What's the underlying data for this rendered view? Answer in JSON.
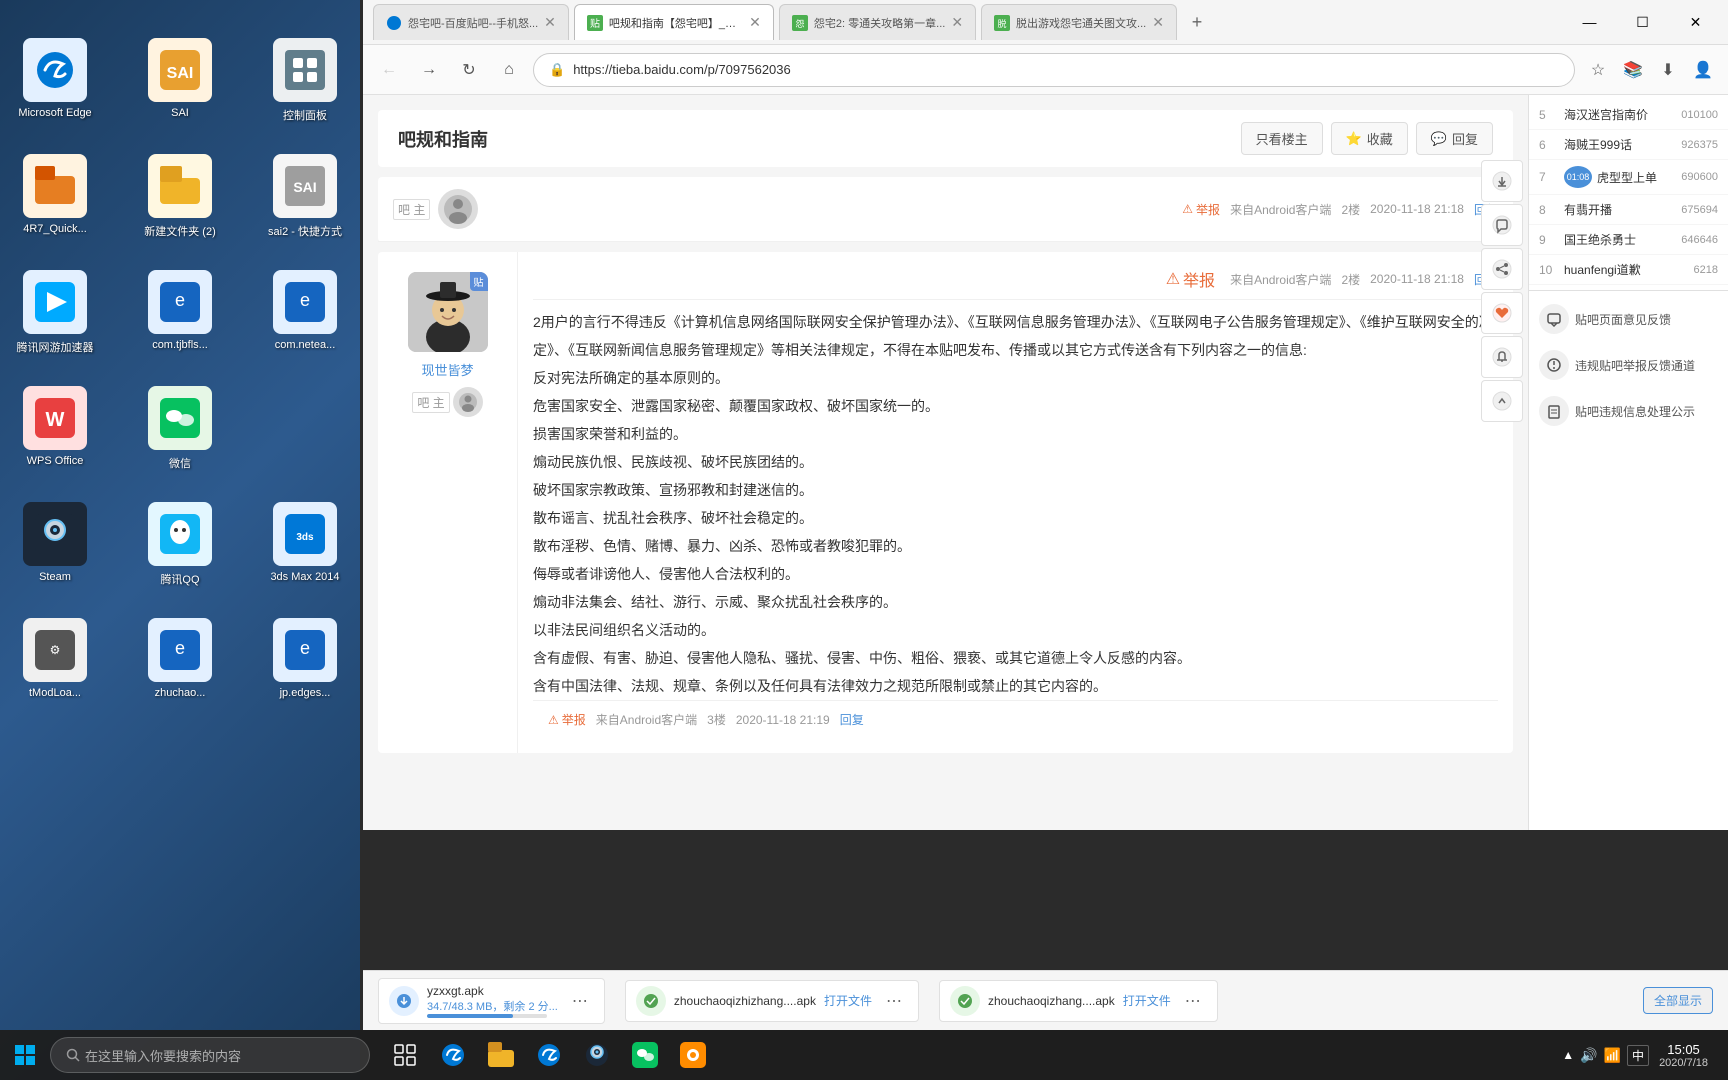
{
  "desktop": {
    "icons": [
      {
        "id": "edge",
        "label": "Microsoft Edge",
        "emoji": "🌐",
        "color": "#0078d4"
      },
      {
        "id": "sai",
        "label": "SAI",
        "emoji": "🎨",
        "color": "#e8a030"
      },
      {
        "id": "control",
        "label": "控制面板",
        "emoji": "⚙️",
        "color": "#607d8b"
      },
      {
        "id": "project",
        "label": "4R7_Quick...",
        "emoji": "📁",
        "color": "#e67e22"
      },
      {
        "id": "new-folder",
        "label": "新建文件夹 (2)",
        "emoji": "📂",
        "color": "#f0b429"
      },
      {
        "id": "method",
        "label": "方式",
        "emoji": "📋",
        "color": "#95a5a6"
      },
      {
        "id": "tencent-accel",
        "label": "腾讯网游加速器",
        "emoji": "🎮",
        "color": "#00aaff"
      },
      {
        "id": "com-tjbfls",
        "label": "com.tjbfls...",
        "emoji": "🌐",
        "color": "#1565c0"
      },
      {
        "id": "com-netea",
        "label": "com.netea...",
        "emoji": "🌐",
        "color": "#1565c0"
      },
      {
        "id": "wps",
        "label": "WPS Office",
        "emoji": "W",
        "color": "#e84040"
      },
      {
        "id": "wechat",
        "label": "微信",
        "emoji": "💬",
        "color": "#07c160"
      },
      {
        "id": "steam",
        "label": "Steam",
        "emoji": "🎮",
        "color": "#1b2838"
      },
      {
        "id": "qq",
        "label": "腾讯QQ",
        "emoji": "🐧",
        "color": "#12b7f5"
      },
      {
        "id": "3dsmax",
        "label": "3ds Max 2014",
        "emoji": "🔷",
        "color": "#0078d7"
      },
      {
        "id": "tmodloader",
        "label": "tModLoa...",
        "emoji": "⚙️",
        "color": "#555"
      },
      {
        "id": "zhuchao",
        "label": "zhuchao...",
        "emoji": "🌐",
        "color": "#1565c0"
      },
      {
        "id": "jpedges2",
        "label": "jp.edges...",
        "emoji": "🌐",
        "color": "#1565c0"
      }
    ]
  },
  "taskbar": {
    "search_placeholder": "在这里输入你要搜索的内容",
    "time": "15:05",
    "date": "2020/7/18",
    "system_tray": [
      "🔊",
      "中"
    ]
  },
  "browser": {
    "tabs": [
      {
        "id": "tab1",
        "label": "怨宅吧-百度贴吧--手机怒...",
        "active": false,
        "favicon": "🔵"
      },
      {
        "id": "tab2",
        "label": "吧规和指南【怨宅吧】_贴...",
        "active": true,
        "favicon": "🟢"
      },
      {
        "id": "tab3",
        "label": "怨宅2: 零通关攻略第一章...",
        "active": false,
        "favicon": "🟩"
      },
      {
        "id": "tab4",
        "label": "脱出游戏怨宅通关图文攻...",
        "active": false,
        "favicon": "🟩"
      }
    ],
    "url": "https://tieba.baidu.com/p/7097562036",
    "page_title": "吧规和指南",
    "action_buttons": [
      "只看楼主",
      "收藏",
      "回复"
    ],
    "post_header": {
      "author_label": "吧 主",
      "meta": "来自Android客户端  2楼  2020-11-18 21:18",
      "report": "举报",
      "reply": "回复"
    },
    "post2": {
      "username": "现世皆梦",
      "author_label": "吧 主",
      "content_lines": [
        "2用户的言行不得违反《计算机信息网络国际联网安全保护管理办法》、《互联网信息服务管理办法》、《互联网电子公告服务管理规定》、《维护互联网安全的决定》、《互联网新闻信息服务管理规定》等相关法律规定,不得在本贴吧发布、传播或以其它方式传送含有下列内容之一的信息:",
        "反对宪法所确定的基本原则的。",
        "危害国家安全、泄露国家秘密、颠覆国家政权、破坏国家统一的。",
        "损害国家荣誉和利益的。",
        "煽动民族仇恨、民族歧视、破坏民族团结的。",
        "破坏国家宗教政策、宣扬邪教和封建迷信的。",
        "散布谣言、扰乱社会秩序、破坏社会稳定的。",
        "散布淫秽、色情、赌博、暴力、凶杀、恐怖或者教唆犯罪的。",
        "侮辱或者诽谤他人、侵害他人合法权利的。",
        "煽动非法集会、结社、游行、示威、聚众扰乱社会秩序的。",
        "以非法民间组织名义活动的。",
        "含有虚假、有害、胁迫、侵害他人隐私、骚扰、侵害、中伤、粗俗、猥亵、或其它道德上令人反感的内容。",
        "含有中国法律、法规、规章、条例以及任何具有法律效力之规范所限制或禁止的其它内容的。"
      ],
      "footer_meta": "来自Android客户端  3楼  2020-11-18 21:19",
      "report": "举报",
      "reply": "回复"
    },
    "right_sidebar": {
      "items": [
        {
          "rank": "5",
          "name": "海汉迷宫指南价",
          "count": "010100"
        },
        {
          "rank": "6",
          "name": "海贼王999话",
          "count": "926375"
        },
        {
          "rank": "7",
          "name": "虎型型上单",
          "count": "690600"
        },
        {
          "rank": "8",
          "name": "有翡开播",
          "count": "675694"
        },
        {
          "rank": "9",
          "name": "国王绝杀勇士",
          "count": "646646"
        },
        {
          "rank": "10",
          "name": "huanfengi道歉",
          "count": "6218"
        }
      ],
      "actions": [
        {
          "label": "贴吧页面意见反馈"
        },
        {
          "label": "违规贴吧举报反馈通道"
        },
        {
          "label": "贴吧违规信息处理公示"
        }
      ]
    },
    "downloads": [
      {
        "name": "yzxxgt.apk",
        "status": "34.7/48.3 MB，剩余 2 分...",
        "progress": 72,
        "icon": "blue",
        "open_label": ""
      },
      {
        "name": "zhouchaoqizhizhang....apk",
        "status": "",
        "progress": 100,
        "icon": "green",
        "open_label": "打开文件"
      },
      {
        "name": "zhouchaoqizhang....apk",
        "status": "",
        "progress": 100,
        "icon": "green",
        "open_label": "打开文件"
      }
    ],
    "show_all": "全部显示"
  }
}
